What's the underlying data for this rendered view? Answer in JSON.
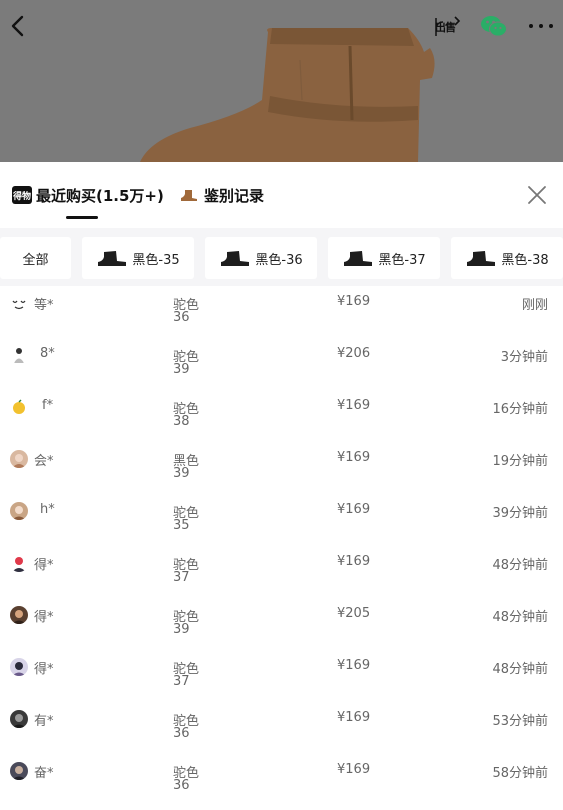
{
  "header": {
    "icons": [
      "back-icon",
      "sell-icon",
      "wechat-icon",
      "more-icon"
    ],
    "sell_text": "出售"
  },
  "tabs": {
    "recent": {
      "label": "最近购买(1.5万+)",
      "icon": "得物"
    },
    "authentication": {
      "label": "鉴别记录"
    }
  },
  "filters": [
    "全部",
    "黑色-35",
    "黑色-36",
    "黑色-37",
    "黑色-38"
  ],
  "purchases": [
    {
      "buyer": "等*",
      "color": "驼色",
      "size": "36",
      "price": "¥169",
      "time": "刚刚"
    },
    {
      "buyer": "8*",
      "color": "驼色",
      "size": "39",
      "price": "¥206",
      "time": "3分钟前"
    },
    {
      "buyer": "f*",
      "color": "驼色",
      "size": "38",
      "price": "¥169",
      "time": "16分钟前"
    },
    {
      "buyer": "会*",
      "color": "黑色",
      "size": "39",
      "price": "¥169",
      "time": "19分钟前"
    },
    {
      "buyer": "h*",
      "color": "驼色",
      "size": "35",
      "price": "¥169",
      "time": "39分钟前"
    },
    {
      "buyer": "得*",
      "color": "驼色",
      "size": "37",
      "price": "¥169",
      "time": "48分钟前"
    },
    {
      "buyer": "得*",
      "color": "驼色",
      "size": "39",
      "price": "¥205",
      "time": "48分钟前"
    },
    {
      "buyer": "得*",
      "color": "驼色",
      "size": "37",
      "price": "¥169",
      "time": "48分钟前"
    },
    {
      "buyer": "有*",
      "color": "驼色",
      "size": "36",
      "price": "¥169",
      "time": "53分钟前"
    },
    {
      "buyer": "奋*",
      "color": "驼色",
      "size": "36",
      "price": "¥169",
      "time": "58分钟前"
    }
  ],
  "colors": {
    "overlay": "#7a7a7a",
    "boot_tan": "#a0693a",
    "text_dark": "#111111",
    "text_muted": "#666666",
    "chip_bg": "#f5f5f7",
    "wechat_green": "#2aae67"
  }
}
